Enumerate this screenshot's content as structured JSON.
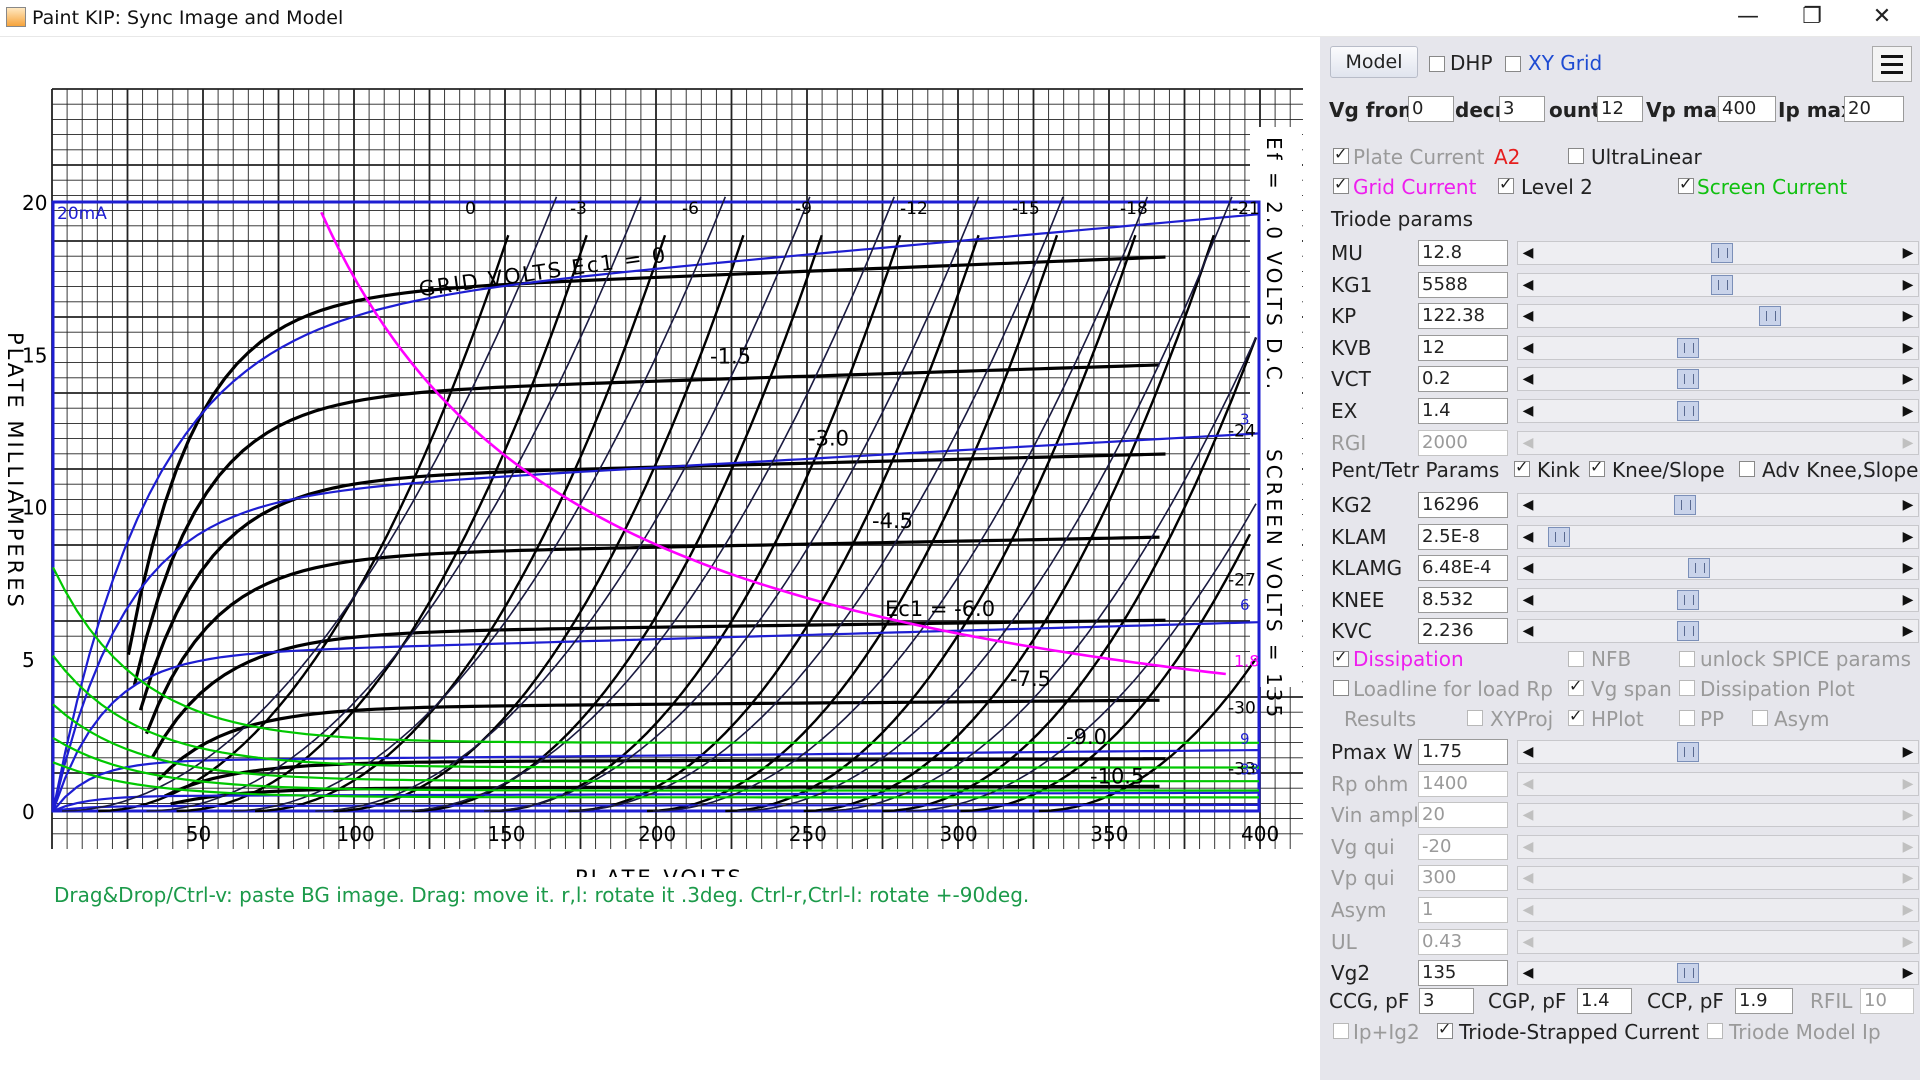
{
  "window": {
    "title": "Paint KIP: Sync Image and Model",
    "minimize_glyph": "—",
    "maximize_glyph": "❐",
    "close_glyph": "✕"
  },
  "chart_area": {
    "hint": "Drag&Drop/Ctrl-v: paste BG image. Drag: move it. r,l: rotate it .3deg. Ctrl-r,Ctrl-l: rotate +-90deg.",
    "overlay_box_label": "20mA"
  },
  "chart_data": {
    "type": "line",
    "x_tick_labels": [
      "50",
      "100",
      "150",
      "200",
      "250",
      "300",
      "350",
      "400"
    ],
    "y_tick_labels": [
      "0",
      "5",
      "10",
      "15",
      "20"
    ],
    "xlim": [
      0,
      400
    ],
    "ylim": [
      0,
      20
    ],
    "xlabel": "PLATE VOLTS",
    "ylabel": "PLATE MILLIAMPERES",
    "right_annotation_1": "Ef = 2.0 VOLTS D.C.",
    "right_annotation_2": "SCREEN VOLTS = 135",
    "scanned_text_1": "GRID VOLTS Ec1 = 0",
    "scanned_text_2": "Ec1 = -6.0",
    "top_grid_labels": [
      "0",
      "-3",
      "-6",
      "-9",
      "-12",
      "-15",
      "-18",
      "-21"
    ],
    "right_grid_labels": [
      "-24",
      "-27",
      "-30",
      "-33"
    ],
    "scanned_curve_labels": [
      "-1.5",
      "-3.0",
      "-4.5",
      "-7.5",
      "-9.0",
      "-10.5"
    ],
    "model_right_labels": [
      "3",
      "6",
      "9",
      "33"
    ],
    "dissipation_label": "1.8",
    "plate_curves_model": [
      {
        "vg": 0,
        "i_at_400": 19.6
      },
      {
        "vg": -3,
        "i_at_400": 12.4
      },
      {
        "vg": -6,
        "i_at_400": 6.2
      },
      {
        "vg": -9,
        "i_at_400": 2.0
      },
      {
        "vg": -12,
        "i_at_400": 0.6
      },
      {
        "vg": -15,
        "i_at_400": 0.2
      }
    ],
    "scanned_curves": [
      {
        "vg": 0,
        "i_at_320": 18.0
      },
      {
        "vg": -1.5,
        "i_at_320": 14.5
      },
      {
        "vg": -3.0,
        "i_at_320": 11.6
      },
      {
        "vg": -4.5,
        "i_at_320": 8.9
      },
      {
        "vg": -6.0,
        "i_at_320": 6.2
      },
      {
        "vg": -7.5,
        "i_at_320": 3.6
      },
      {
        "vg": -9.0,
        "i_at_320": 1.7
      },
      {
        "vg": -10.5,
        "i_at_320": 0.8
      }
    ],
    "dissipation_limit_w": 1.75,
    "colors": {
      "model": "#1e1ed2",
      "grid_current": "#ff00ff",
      "screen_current": "#00c800",
      "scan": "#000000"
    }
  },
  "panel": {
    "model_button": "Model",
    "dhp": {
      "label": "DHP",
      "checked": false
    },
    "xy_grid": {
      "label": "XY Grid",
      "checked": false
    },
    "row_vg": {
      "vg_from_label": "Vg from",
      "vg_from": "0",
      "decr_label": "decr",
      "decr": "3",
      "count_label": "ount",
      "count": "12",
      "vp_max_label": "Vp max",
      "vp_max": "400",
      "ip_max_label": "Ip max",
      "ip_max": "20"
    },
    "plate_current": {
      "label": "Plate Current",
      "checked": true
    },
    "a2_label": "A2",
    "ultralinear": {
      "label": "UltraLinear",
      "checked": false
    },
    "grid_current": {
      "label": "Grid Current",
      "checked": true
    },
    "level2": {
      "label": "Level 2",
      "checked": true
    },
    "screen_current": {
      "label": "Screen Current",
      "checked": true
    },
    "triode_header": "Triode params",
    "params": [
      {
        "name": "MU",
        "value": "12.8",
        "thumb": 0.51
      },
      {
        "name": "KG1",
        "value": "5588",
        "thumb": 0.51
      },
      {
        "name": "KP",
        "value": "122.38",
        "thumb": 0.65
      },
      {
        "name": "KVB",
        "value": "12",
        "thumb": 0.41
      },
      {
        "name": "VCT",
        "value": "0.2",
        "thumb": 0.41
      },
      {
        "name": "EX",
        "value": "1.4",
        "thumb": 0.41
      },
      {
        "name": "RGI",
        "value": "2000",
        "disabled": true
      }
    ],
    "pent_header": "Pent/Tetr Params",
    "kink": {
      "label": "Kink",
      "checked": true
    },
    "knee_slope": {
      "label": "Knee/Slope",
      "checked": true
    },
    "adv_knee": {
      "label": "Adv Knee,Slope",
      "checked": false
    },
    "pent_params": [
      {
        "name": "KG2",
        "value": "16296",
        "thumb": 0.4
      },
      {
        "name": "KLAM",
        "value": "2.5E-8",
        "thumb": 0.03
      },
      {
        "name": "KLAMG",
        "value": "6.48E-4",
        "thumb": 0.44
      },
      {
        "name": "KNEE",
        "value": "8.532",
        "thumb": 0.41
      },
      {
        "name": "KVC",
        "value": "2.236",
        "thumb": 0.41
      }
    ],
    "dissipation": {
      "label": "Dissipation",
      "checked": true
    },
    "nfb": {
      "label": "NFB",
      "checked": false
    },
    "unlock_spice": {
      "label": "unlock SPICE params",
      "checked": false
    },
    "loadline": {
      "label": "Loadline for load Rp",
      "checked": false
    },
    "vg_span": {
      "label": "Vg span",
      "checked": true
    },
    "dissipation_plot": {
      "label": "Dissipation Plot",
      "checked": false
    },
    "results_label": "Results",
    "xyproj": {
      "label": "XYProj",
      "checked": false
    },
    "hplot": {
      "label": "HPlot",
      "checked": true
    },
    "pp": {
      "label": "PP",
      "checked": false
    },
    "asym_cb": {
      "label": "Asym",
      "checked": false
    },
    "load_params": [
      {
        "name": "Pmax W",
        "value": "1.75",
        "thumb": 0.41
      },
      {
        "name": "Rp ohm",
        "value": "1400",
        "disabled": true
      },
      {
        "name": "Vin ampl",
        "value": "20",
        "disabled": true
      },
      {
        "name": "Vg qui",
        "value": "-20",
        "disabled": true
      },
      {
        "name": "Vp qui",
        "value": "300",
        "disabled": true
      },
      {
        "name": "Asym",
        "value": "1",
        "disabled": true
      },
      {
        "name": "UL",
        "value": "0.43",
        "disabled": true
      },
      {
        "name": "Vg2",
        "value": "135",
        "thumb": 0.41
      }
    ],
    "caps": {
      "ccg_label": "CCG, pF",
      "ccg": "3",
      "cgp_label": "CGP, pF",
      "cgp": "1.4",
      "ccp_label": "CCP, pF",
      "ccp": "1.9",
      "rfil_label": "RFIL",
      "rfil": "10"
    },
    "ip_ig2": {
      "label": "Ip+Ig2",
      "checked": false
    },
    "triode_strapped": {
      "label": "Triode-Strapped Current",
      "checked": true
    },
    "triode_model_ip": {
      "label": "Triode Model Ip",
      "checked": false
    }
  }
}
